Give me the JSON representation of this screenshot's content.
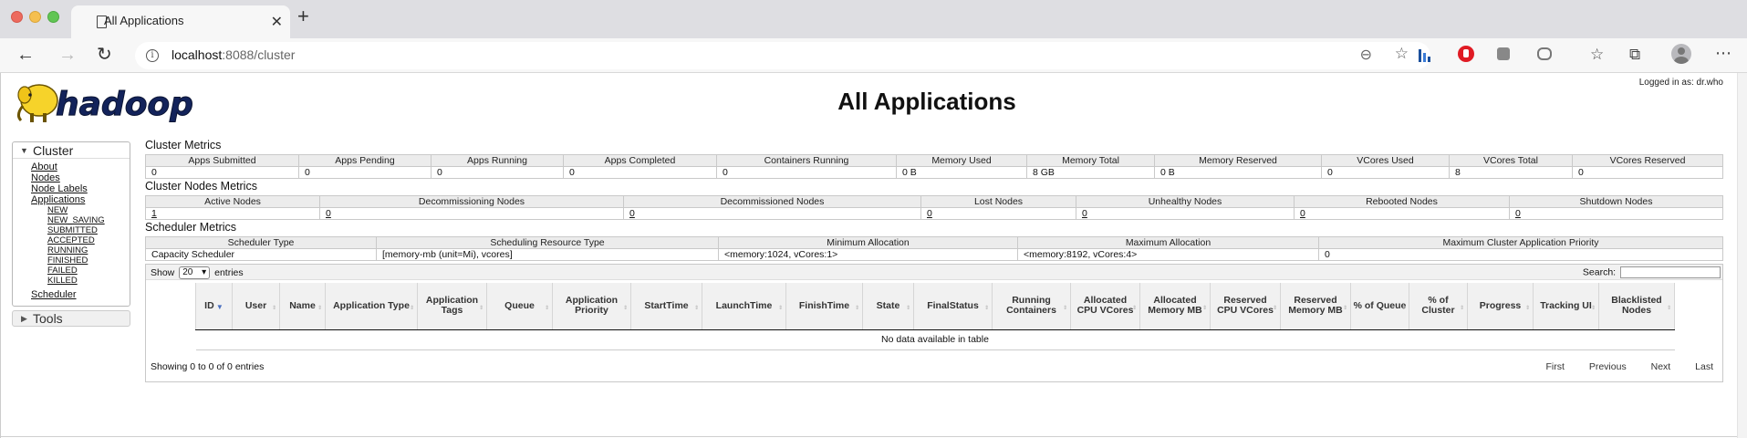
{
  "browser": {
    "tab_title": "All Applications",
    "url_host": "localhost",
    "url_rest": ":8088/cluster",
    "icons": [
      "page-icon",
      "close-icon",
      "plus-icon",
      "back-icon",
      "forward-icon",
      "reload-icon",
      "info-icon",
      "zoom-out-icon",
      "star-icon",
      "favorites-icon",
      "collections-icon",
      "profile-icon",
      "more-icon"
    ]
  },
  "header": {
    "logo_text": "hadoop",
    "title": "All Applications",
    "logged_in": "Logged in as: dr.who"
  },
  "sidebar": {
    "cluster_label": "Cluster",
    "links": [
      "About",
      "Nodes",
      "Node Labels",
      "Applications"
    ],
    "app_states": [
      "NEW",
      "NEW_SAVING",
      "SUBMITTED",
      "ACCEPTED",
      "RUNNING",
      "FINISHED",
      "FAILED",
      "KILLED"
    ],
    "scheduler": "Scheduler",
    "tools_label": "Tools"
  },
  "cluster_metrics": {
    "title": "Cluster Metrics",
    "headers": [
      "Apps Submitted",
      "Apps Pending",
      "Apps Running",
      "Apps Completed",
      "Containers Running",
      "Memory Used",
      "Memory Total",
      "Memory Reserved",
      "VCores Used",
      "VCores Total",
      "VCores Reserved"
    ],
    "values": [
      "0",
      "0",
      "0",
      "0",
      "0",
      "0 B",
      "8 GB",
      "0 B",
      "0",
      "8",
      "0"
    ]
  },
  "node_metrics": {
    "title": "Cluster Nodes Metrics",
    "headers": [
      "Active Nodes",
      "Decommissioning Nodes",
      "Decommissioned Nodes",
      "Lost Nodes",
      "Unhealthy Nodes",
      "Rebooted Nodes",
      "Shutdown Nodes"
    ],
    "values": [
      "1",
      "0",
      "0",
      "0",
      "0",
      "0",
      "0"
    ]
  },
  "scheduler_metrics": {
    "title": "Scheduler Metrics",
    "headers": [
      "Scheduler Type",
      "Scheduling Resource Type",
      "Minimum Allocation",
      "Maximum Allocation",
      "Maximum Cluster Application Priority"
    ],
    "values": [
      "Capacity Scheduler",
      "[memory-mb (unit=Mi), vcores]",
      "<memory:1024, vCores:1>",
      "<memory:8192, vCores:4>",
      "0"
    ]
  },
  "apps_table": {
    "show_label": "Show",
    "entries_value": "20",
    "entries_label": "entries",
    "search_label": "Search:",
    "columns": [
      "ID",
      "User",
      "Name",
      "Application Type",
      "Application Tags",
      "Queue",
      "Application Priority",
      "StartTime",
      "LaunchTime",
      "FinishTime",
      "State",
      "FinalStatus",
      "Running Containers",
      "Allocated CPU VCores",
      "Allocated Memory MB",
      "Reserved CPU VCores",
      "Reserved Memory MB",
      "% of Queue",
      "% of Cluster",
      "Progress",
      "Tracking UI",
      "Blacklisted Nodes"
    ],
    "empty_message": "No data available in table",
    "info": "Showing 0 to 0 of 0 entries",
    "pager": [
      "First",
      "Previous",
      "Next",
      "Last"
    ]
  }
}
